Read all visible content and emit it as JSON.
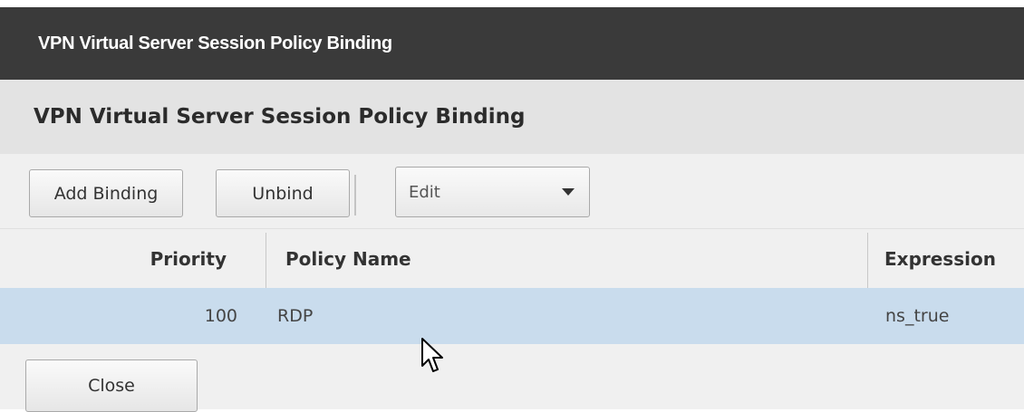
{
  "dialog": {
    "title": "VPN Virtual Server Session Policy Binding",
    "section_title": "VPN Virtual Server Session Policy Binding"
  },
  "toolbar": {
    "add_binding_label": "Add Binding",
    "unbind_label": "Unbind",
    "action_select_value": "Edit"
  },
  "table": {
    "columns": [
      "Priority",
      "Policy Name",
      "Expression"
    ],
    "rows": [
      {
        "priority": "100",
        "policy_name": "RDP",
        "expression": "ns_true",
        "selected": true
      }
    ]
  },
  "footer": {
    "close_label": "Close"
  },
  "colors": {
    "titlebar_bg": "#3a3a3a",
    "section_bg": "#e3e3e3",
    "selected_row_bg": "#c9dced"
  },
  "icons": {
    "select_caret": "chevron-down-icon",
    "pointer": "mouse-cursor-icon"
  }
}
